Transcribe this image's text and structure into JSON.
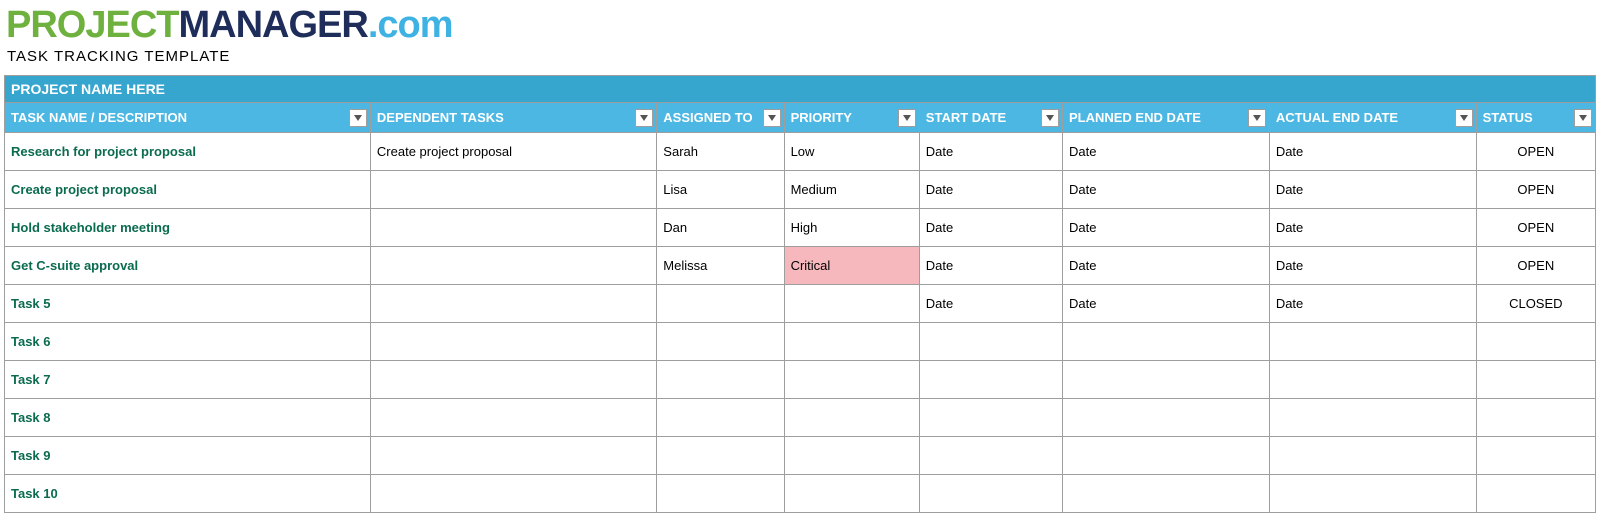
{
  "logo": {
    "part1": "PROJECT",
    "part2": "MANAGER",
    "part3": ".com"
  },
  "subtitle": "TASK TRACKING TEMPLATE",
  "project_title": "PROJECT NAME HERE",
  "columns": [
    "TASK NAME / DESCRIPTION",
    "DEPENDENT TASKS",
    "ASSIGNED TO",
    "PRIORITY",
    "START DATE",
    "PLANNED END DATE",
    "ACTUAL END DATE",
    "STATUS"
  ],
  "rows": [
    {
      "task": "Research for project proposal",
      "dependent": "Create project proposal",
      "assigned": "Sarah",
      "priority": "Low",
      "start": "Date",
      "planned": "Date",
      "actual": "Date",
      "status": "OPEN"
    },
    {
      "task": "Create project proposal",
      "dependent": "",
      "assigned": "Lisa",
      "priority": "Medium",
      "start": "Date",
      "planned": "Date",
      "actual": "Date",
      "status": "OPEN"
    },
    {
      "task": "Hold stakeholder meeting",
      "dependent": "",
      "assigned": "Dan",
      "priority": "High",
      "start": "Date",
      "planned": "Date",
      "actual": "Date",
      "status": "OPEN"
    },
    {
      "task": "Get C-suite approval",
      "dependent": "",
      "assigned": "Melissa",
      "priority": "Critical",
      "start": "Date",
      "planned": "Date",
      "actual": "Date",
      "status": "OPEN"
    },
    {
      "task": "Task 5",
      "dependent": "",
      "assigned": "",
      "priority": "",
      "start": "Date",
      "planned": "Date",
      "actual": "Date",
      "status": "CLOSED"
    },
    {
      "task": "Task 6",
      "dependent": "",
      "assigned": "",
      "priority": "",
      "start": "",
      "planned": "",
      "actual": "",
      "status": ""
    },
    {
      "task": "Task 7",
      "dependent": "",
      "assigned": "",
      "priority": "",
      "start": "",
      "planned": "",
      "actual": "",
      "status": ""
    },
    {
      "task": "Task 8",
      "dependent": "",
      "assigned": "",
      "priority": "",
      "start": "",
      "planned": "",
      "actual": "",
      "status": ""
    },
    {
      "task": "Task 9",
      "dependent": "",
      "assigned": "",
      "priority": "",
      "start": "",
      "planned": "",
      "actual": "",
      "status": ""
    },
    {
      "task": "Task 10",
      "dependent": "",
      "assigned": "",
      "priority": "",
      "start": "",
      "planned": "",
      "actual": "",
      "status": ""
    }
  ]
}
